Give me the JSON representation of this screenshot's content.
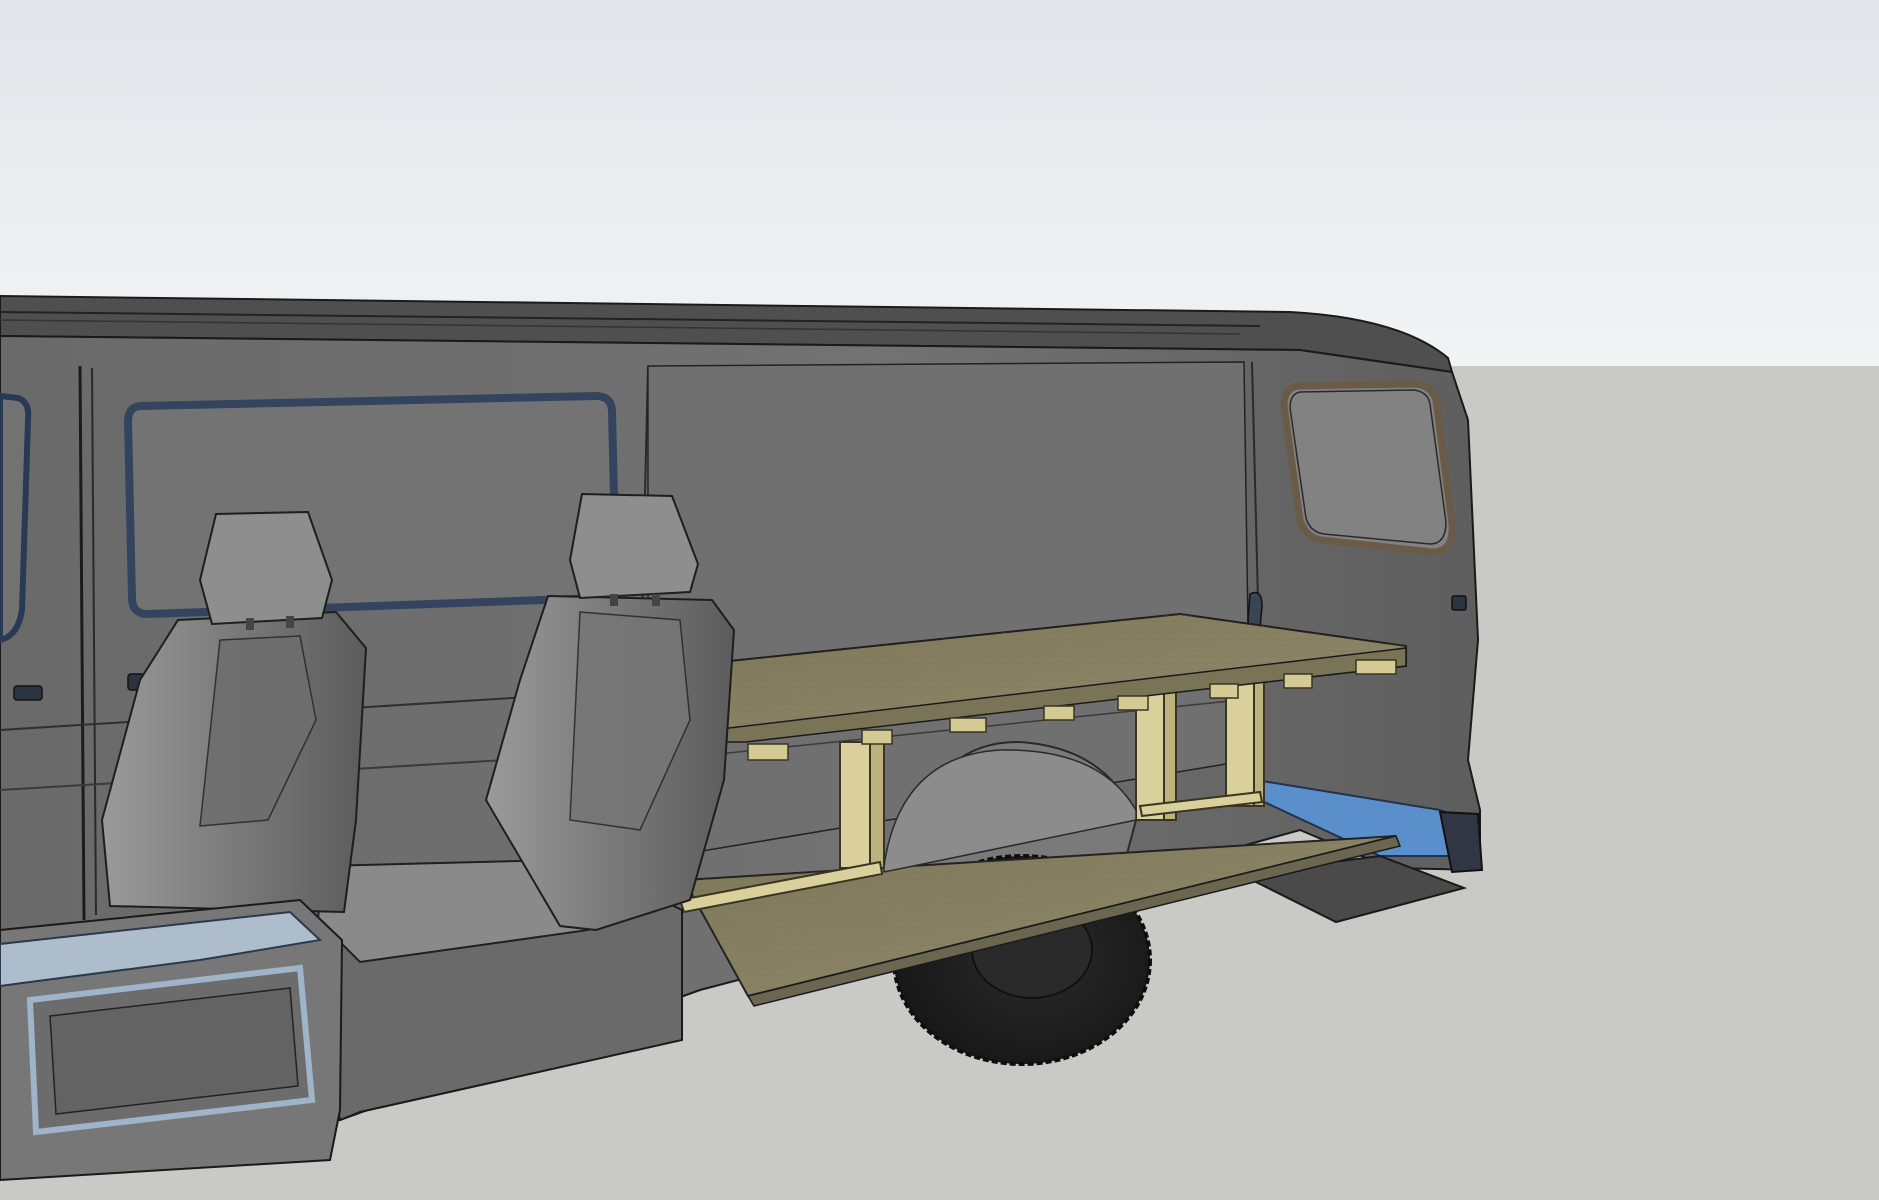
{
  "scene": {
    "sky_top": "#e8eaee",
    "sky_bottom": "#f1f2f4",
    "ground": "#c8c8c4",
    "van_body": "#6e6e6e",
    "van_roof": "#555555",
    "window_frame_blue": "#3a4a66",
    "window_frame_brown": "#6b5a48",
    "plywood": "#8a8264",
    "pine_frame": "#d8cf9a",
    "seat": "#7c7c7c",
    "step_blue": "#5a8fcc"
  },
  "objects": [
    "van-body",
    "side-window",
    "rear-window",
    "driver-seat",
    "passenger-seat",
    "bed-platform",
    "lower-floor",
    "wheel-well",
    "rear-tire",
    "seat-base",
    "door-handle"
  ]
}
